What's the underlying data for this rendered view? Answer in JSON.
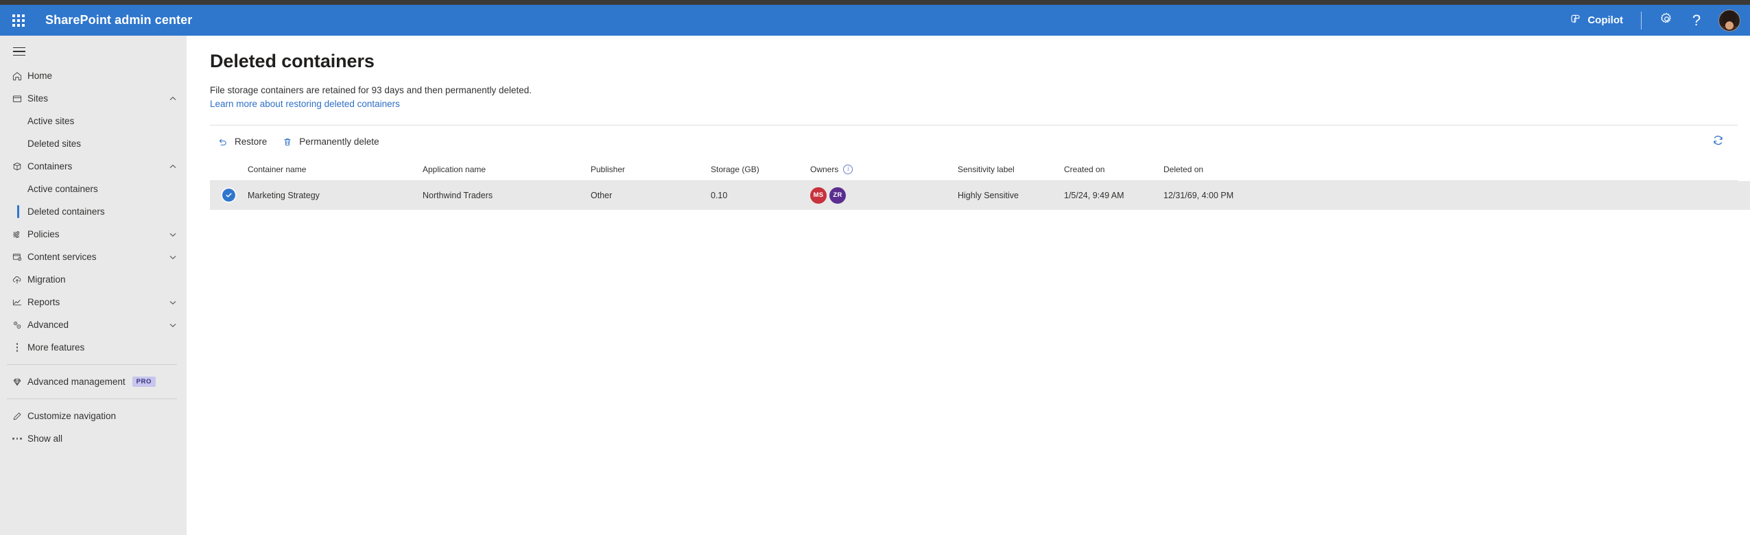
{
  "header": {
    "waffle_icon": "app-launcher-icon",
    "title": "SharePoint admin center",
    "copilot_label": "Copilot",
    "copilot_icon": "copilot-icon",
    "settings_icon": "gear-icon",
    "help_icon": "question-mark-icon",
    "help_glyph": "?",
    "avatar_icon": "user-avatar",
    "bg_color": "#2f76cd"
  },
  "sidebar": {
    "hamburger_icon": "hamburger-menu-icon",
    "bg_color": "#e9e9e9",
    "accent_color": "#2f76cd",
    "items": [
      {
        "label": "Home",
        "icon": "home-icon",
        "type": "item",
        "chevron": ""
      },
      {
        "label": "Sites",
        "icon": "sites-icon",
        "type": "item",
        "chevron": "up"
      },
      {
        "label": "Active sites",
        "icon": "",
        "type": "sub",
        "selected": false
      },
      {
        "label": "Deleted sites",
        "icon": "",
        "type": "sub",
        "selected": false
      },
      {
        "label": "Containers",
        "icon": "container-box-icon",
        "type": "item",
        "chevron": "up"
      },
      {
        "label": "Active containers",
        "icon": "",
        "type": "sub",
        "selected": false
      },
      {
        "label": "Deleted containers",
        "icon": "",
        "type": "sub",
        "selected": true
      },
      {
        "label": "Policies",
        "icon": "policies-sliders-icon",
        "type": "item",
        "chevron": "down"
      },
      {
        "label": "Content services",
        "icon": "content-services-icon",
        "type": "item",
        "chevron": "down"
      },
      {
        "label": "Migration",
        "icon": "migration-cloud-icon",
        "type": "item",
        "chevron": ""
      },
      {
        "label": "Reports",
        "icon": "reports-chart-icon",
        "type": "item",
        "chevron": "down"
      },
      {
        "label": "Advanced",
        "icon": "advanced-gears-icon",
        "type": "item",
        "chevron": "down"
      },
      {
        "label": "More features",
        "icon": "more-vertical-dots-icon",
        "type": "item",
        "chevron": ""
      },
      {
        "label": "Advanced management",
        "icon": "diamond-icon",
        "type": "item",
        "badge": "PRO"
      },
      {
        "label": "Customize navigation",
        "icon": "pencil-icon",
        "type": "item",
        "chevron": ""
      },
      {
        "label": "Show all",
        "icon": "ellipsis-icon",
        "type": "item",
        "chevron": ""
      }
    ]
  },
  "main": {
    "page_title": "Deleted containers",
    "description": "File storage containers are retained for 93 days and then permanently deleted.",
    "learn_more_link": "Learn more about restoring deleted containers",
    "link_color": "#2f6fc6",
    "toolbar": {
      "restore_label": "Restore",
      "restore_icon": "undo-arrow-icon",
      "delete_label": "Permanently delete",
      "delete_icon": "trash-can-icon",
      "refresh_icon": "refresh-icon"
    },
    "table": {
      "columns": [
        "Container name",
        "Application name",
        "Publisher",
        "Storage (GB)",
        "Owners",
        "Sensitivity label",
        "Created on",
        "Deleted on"
      ],
      "owners_info_icon": "info-icon",
      "rows": [
        {
          "selected": true,
          "container_name": "Marketing Strategy",
          "application_name": "Northwind Traders",
          "publisher": "Other",
          "storage_gb": "0.10",
          "owners": [
            {
              "initials": "MS",
              "color": "#c8323c"
            },
            {
              "initials": "ZR",
              "color": "#5b2d90"
            }
          ],
          "sensitivity_label": "Highly Sensitive",
          "created_on": "1/5/24, 9:49 AM",
          "deleted_on": "12/31/69, 4:00 PM"
        }
      ]
    }
  }
}
